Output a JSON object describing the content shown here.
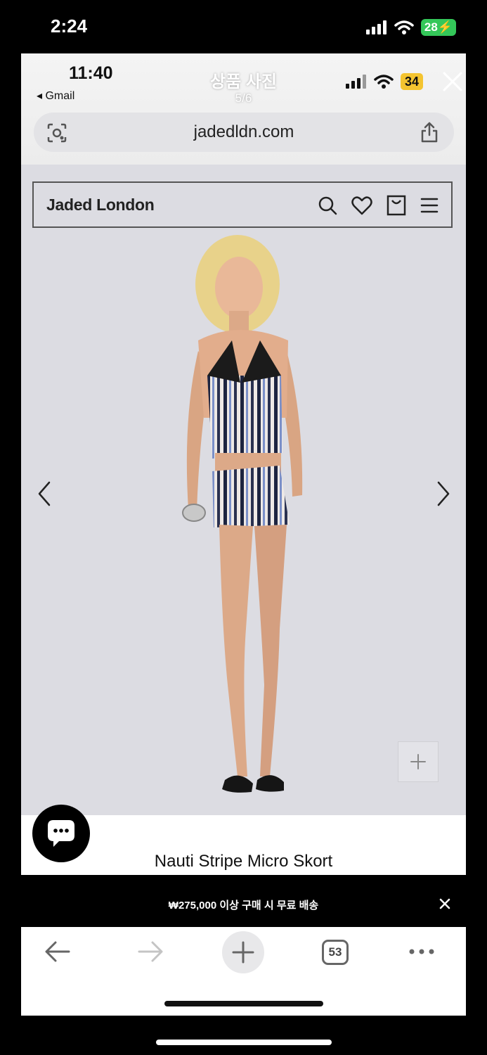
{
  "status_bar": {
    "time": "2:24",
    "battery": "28"
  },
  "viewer": {
    "time": "11:40",
    "back_app": "◂ Gmail",
    "title": "상품 사진",
    "counter": "5/6",
    "battery": "34"
  },
  "browser": {
    "url": "jadedldn.com",
    "tab_count": "53"
  },
  "site": {
    "brand": "Jaded London",
    "product_title": "Nauti Stripe Micro Skort"
  },
  "promo": {
    "text": "₩275,000 이상 구매 시 무료 배송"
  },
  "icons": {
    "lens": "lens-icon",
    "share": "share-icon",
    "search": "search-icon",
    "wishlist": "heart-icon",
    "bag": "bag-icon",
    "menu": "menu-icon",
    "chat": "chat-icon",
    "close": "close-icon"
  },
  "colors": {
    "battery_green": "#34c759",
    "battery_yellow": "#f4c430",
    "photo_bg": "#dcdce2"
  }
}
